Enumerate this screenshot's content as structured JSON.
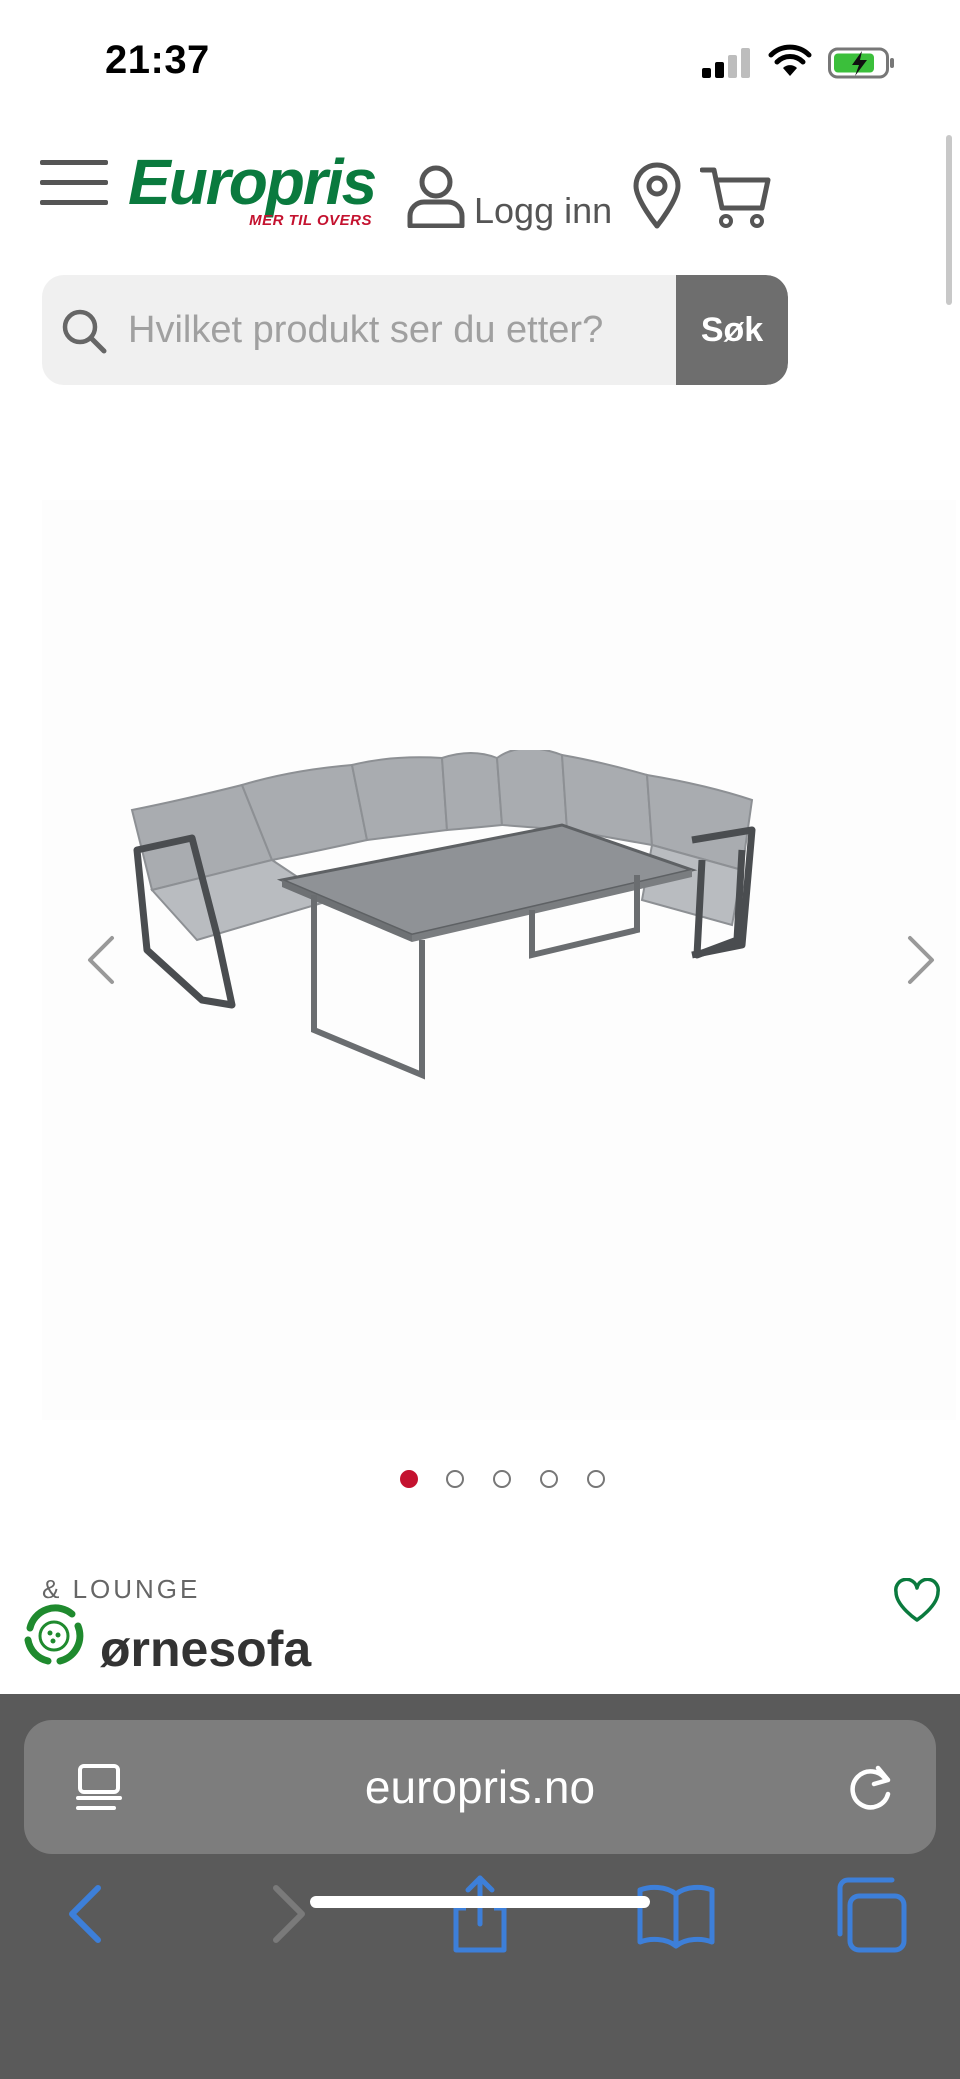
{
  "status_bar": {
    "time": "21:37"
  },
  "header": {
    "logo_text": "Europris",
    "logo_tagline": "MER TIL OVERS",
    "login_label": "Logg inn"
  },
  "search": {
    "placeholder": "Hvilket produkt ser du etter?",
    "button_label": "Søk"
  },
  "carousel": {
    "slide_count": 5,
    "active_slide": 1
  },
  "product": {
    "category": "& LOUNGE",
    "title": "ørnesofa"
  },
  "browser": {
    "url": "europris.no"
  },
  "colors": {
    "brand_green": "#0a7a3e",
    "brand_red": "#c4122f",
    "ios_blue": "#3d7fd9",
    "toolbar_bg": "#5a5a5a"
  },
  "icons": [
    "menu-icon",
    "user-icon",
    "location-pin-icon",
    "cart-icon",
    "search-icon",
    "chevron-left-icon",
    "chevron-right-icon",
    "heart-icon",
    "recycle-icon",
    "reader-icon",
    "reload-icon",
    "back-icon",
    "forward-icon",
    "share-icon",
    "bookmarks-icon",
    "tabs-icon"
  ]
}
